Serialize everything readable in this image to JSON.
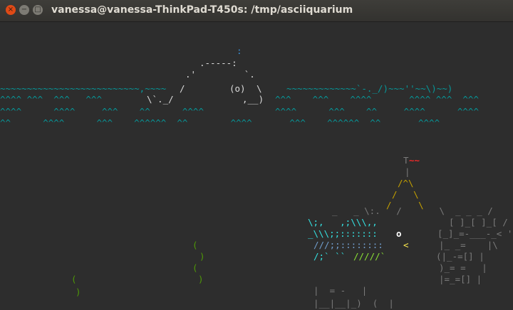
{
  "window": {
    "title": "vanessa@vanessa-ThinkPad-T450s: /tmp/asciiquarium",
    "close_glyph": "×",
    "minimize_glyph": "−",
    "maximize_glyph": "□"
  },
  "colors": {
    "water": "#06989a",
    "background": "#2d2d2d",
    "seaweed": "#4e9a06",
    "castle": "#7a7a7a",
    "flag": "#ef2929"
  },
  "whale": {
    "spout": ":",
    "top": ".-----:",
    "upper": ".'         `.",
    "tail_top": "/",
    "eye": "(o)",
    "back": "\\",
    "tail_bottom": "\\`._/",
    "mouth": ",__)"
  },
  "water": {
    "row1_left": "~~~~~~~~~~~~~~~~~~~~~~~~~~,~~~~",
    "row1_right": "~~~~~~~~~~~~~`-._/)~~~''~~\\)~~)",
    "row2_left": "^^^^ ^^^  ^^^   ^^^     ",
    "row2_right": "^^^    ^^^    ^^^^       ^^^^ ^^^  ^^^",
    "row3_left": "^^^^      ^^^^     ^^^    ^^      ^^^^",
    "row3_right": "^^^^      ^^^    ^^     ^^^^      ^^^^",
    "row4": "^^      ^^^^      ^^^    ^^^^^^  ^^        ^^^^       ^^^    ^^^^^^  ^^       ^^^^"
  },
  "castle": {
    "flag": "~~",
    "pole": "T",
    "pipe": "|",
    "roof1": "/^\\",
    "roof2": "/   \\",
    "roof3": "/     \\",
    "wall1": "_   _ \\:.   /       \\  _ _ _ /",
    "wall2": "[ ]_[ ]_[ /",
    "wall3": "[_]_=-___-_< '",
    "wall4": "|_ _=    |\\",
    "wall5": "(|_-=[] |",
    "wall6": ")_= =   |",
    "wall7": "|=_=[] |",
    "wall8": "|  = -   |",
    "wall9": "|__|__|_)  (  |"
  },
  "fish": {
    "line1": "\\;,   ,;\\\\\\,,",
    "line2": "_\\\\\\;;:::::::",
    "eye": "o",
    "line3": "///;;::::::::",
    "mouth": "<",
    "line4": "/;` ``",
    "tail": "/////`"
  },
  "seaweed": [
    "(",
    ")",
    "(",
    ")",
    "(",
    ")"
  ]
}
